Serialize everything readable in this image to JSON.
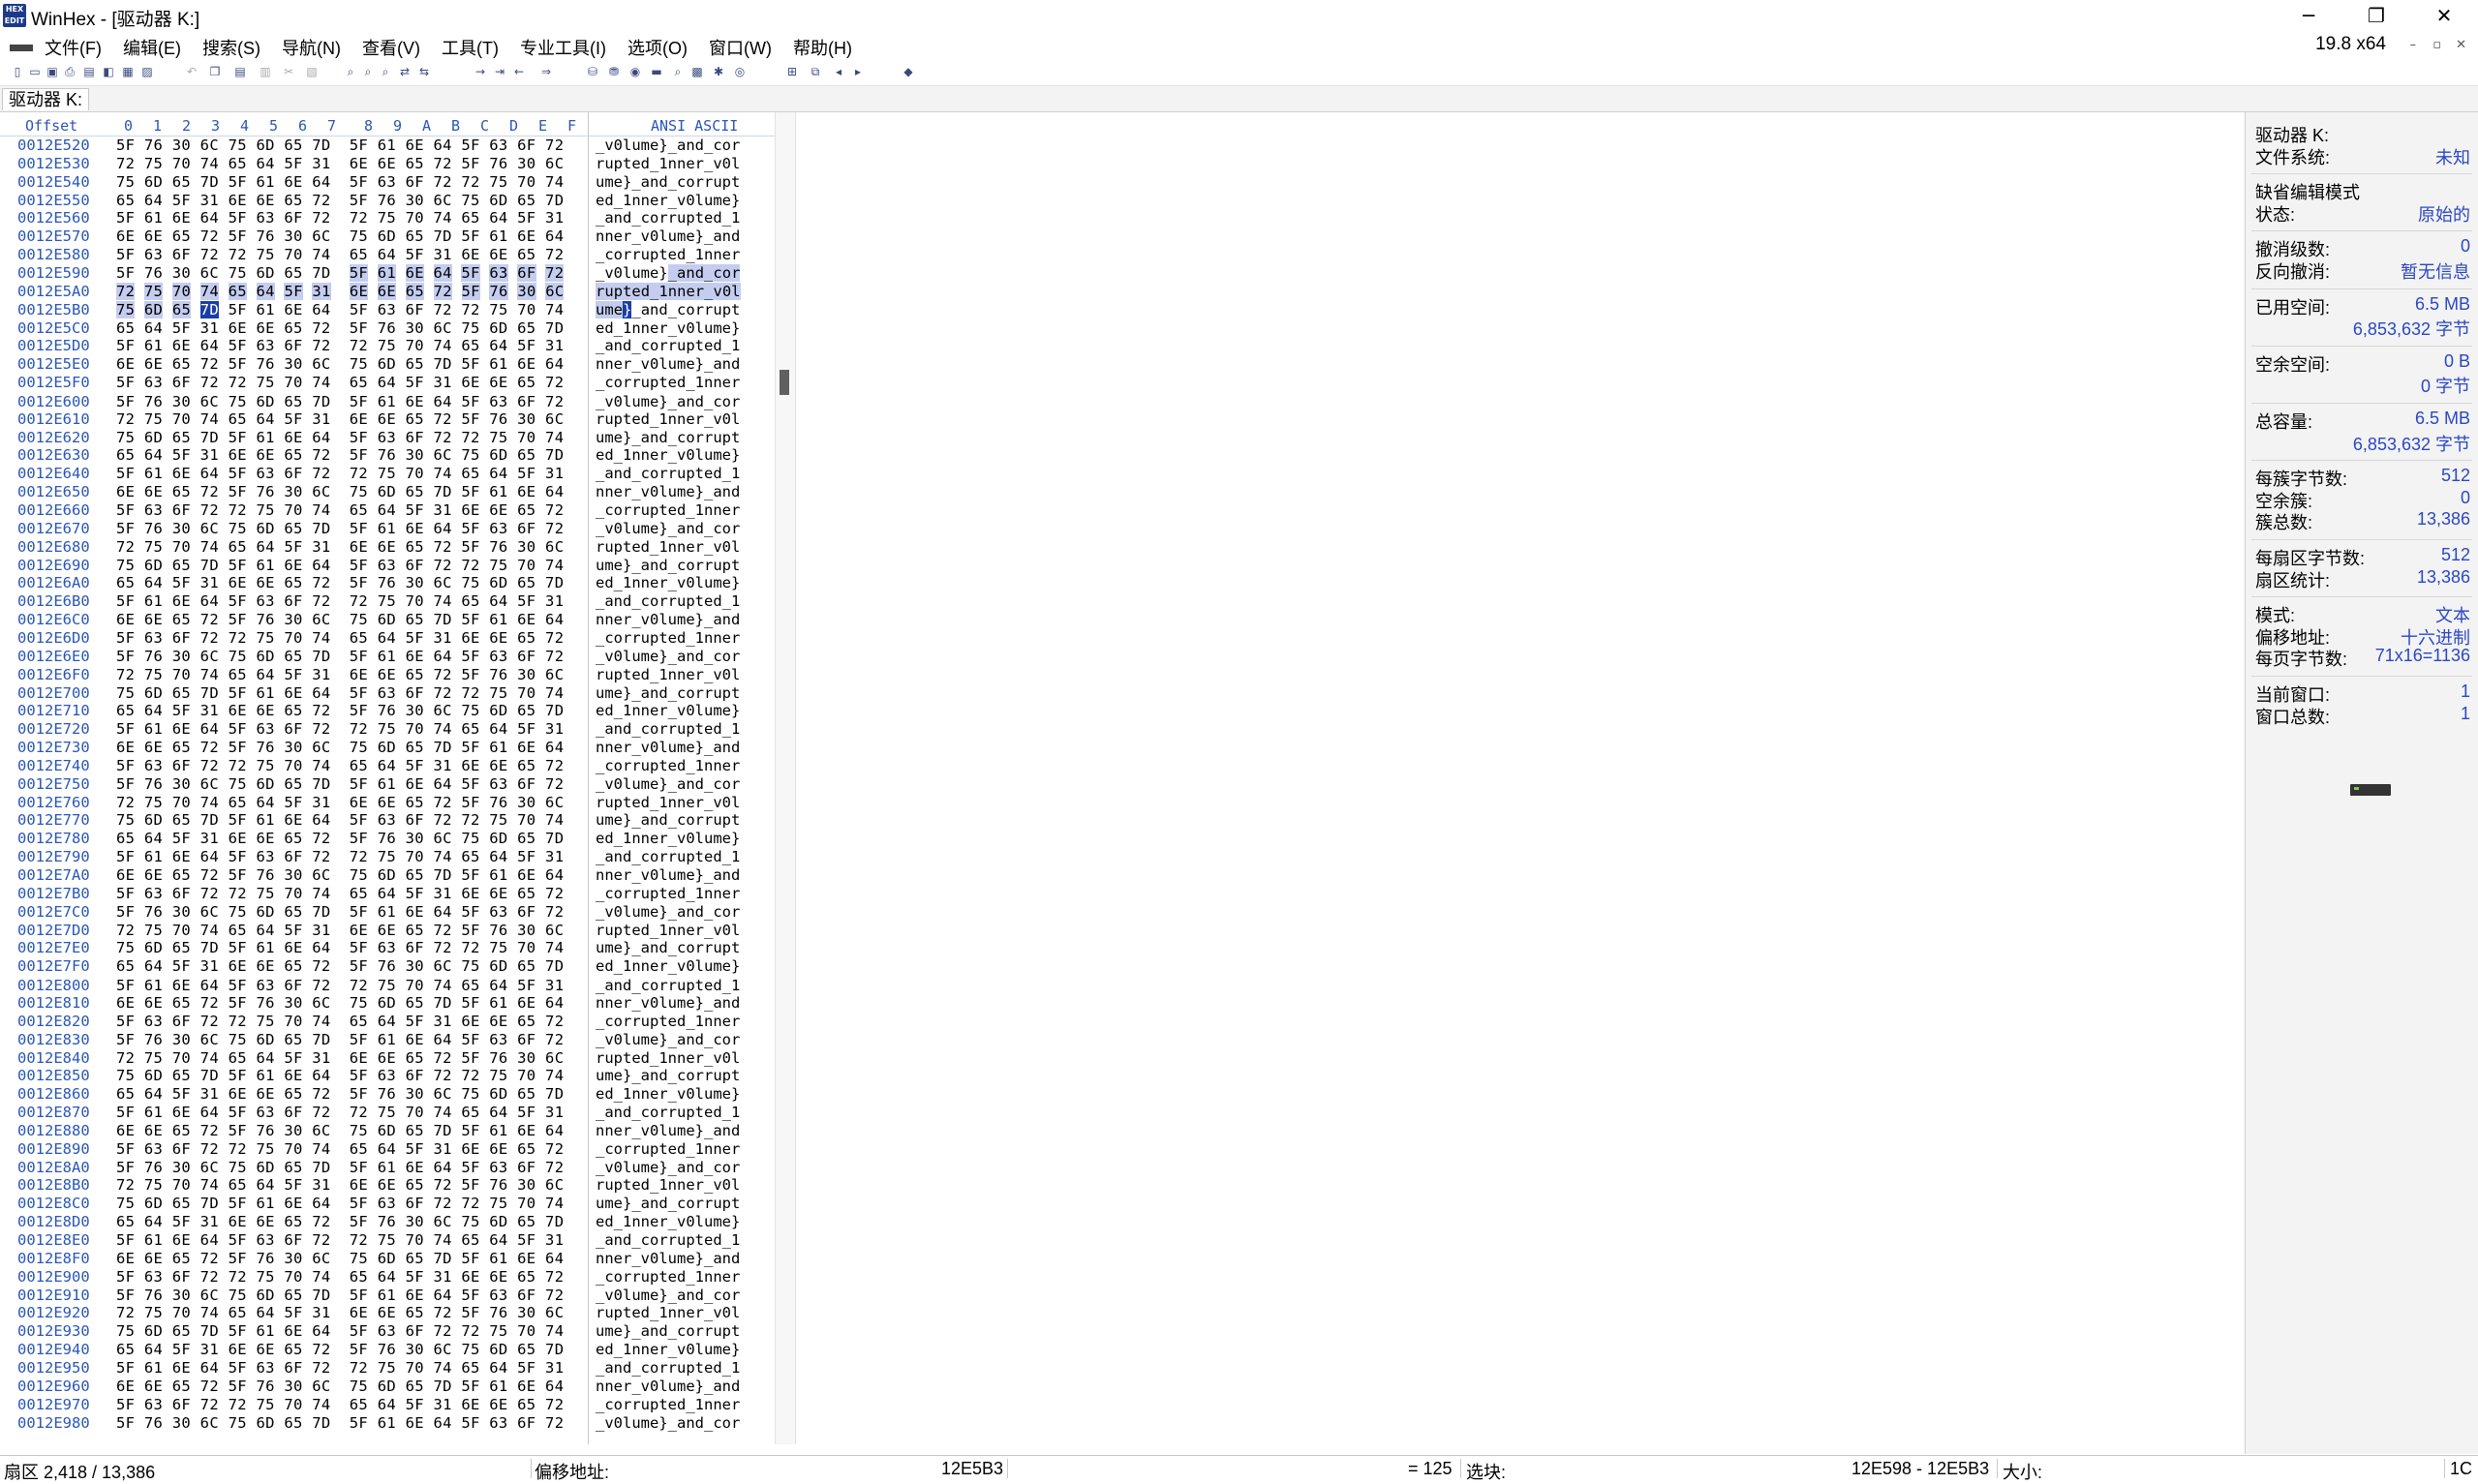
{
  "window": {
    "title": "WinHex - [驱动器 K:]",
    "icon_lines": [
      "HEX",
      "EDIT"
    ],
    "minimize_icon": "─",
    "restore_icon": "❐",
    "close_icon": "✕"
  },
  "menubar": {
    "items": [
      "文件(F)",
      "编辑(E)",
      "搜索(S)",
      "导航(N)",
      "查看(V)",
      "工具(T)",
      "专业工具(I)",
      "选项(O)",
      "窗口(W)",
      "帮助(H)"
    ],
    "version": "19.8 x64",
    "mdi_minimize": "–",
    "mdi_restore": "▫",
    "mdi_close": "✕"
  },
  "toolbar": {
    "icons": [
      "new-file",
      "open-file",
      "save-file",
      "print",
      "properties",
      "open-disk",
      "open-ram",
      "open-image",
      "undo",
      "copy",
      "paste",
      "paste-block",
      "cut",
      "binary-copy",
      "find-text",
      "find-hex",
      "find-next",
      "replace",
      "replace-hex",
      "goto-offset",
      "goto-sector",
      "back",
      "forward",
      "disk-tools",
      "disk-clone",
      "disk-image",
      "ram-tool",
      "search-tool",
      "calc-tool",
      "hash-tool",
      "analyze-tool",
      "tile-windows",
      "cascade-windows",
      "prev-window",
      "next-window",
      "view-tool"
    ]
  },
  "tab": {
    "label": "驱动器 K:"
  },
  "hexview": {
    "offset_header": "Offset",
    "columns": [
      "0",
      "1",
      "2",
      "3",
      "4",
      "5",
      "6",
      "7",
      "8",
      "9",
      "A",
      "B",
      "C",
      "D",
      "E",
      "F"
    ],
    "ascii_header": "ANSI ASCII",
    "rows": [
      {
        "o": "0012E520",
        "h": "5F 76 30 6C 75 6D 65 7D  5F 61 6E 64 5F 63 6F 72",
        "a": "_v0lume}_and_cor"
      },
      {
        "o": "0012E530",
        "h": "72 75 70 74 65 64 5F 31  6E 6E 65 72 5F 76 30 6C",
        "a": "rupted_1nner_v0l"
      },
      {
        "o": "0012E540",
        "h": "75 6D 65 7D 5F 61 6E 64  5F 63 6F 72 72 75 70 74",
        "a": "ume}_and_corrupt"
      },
      {
        "o": "0012E550",
        "h": "65 64 5F 31 6E 6E 65 72  5F 76 30 6C 75 6D 65 7D",
        "a": "ed_1nner_v0lume}"
      },
      {
        "o": "0012E560",
        "h": "5F 61 6E 64 5F 63 6F 72  72 75 70 74 65 64 5F 31",
        "a": "_and_corrupted_1"
      },
      {
        "o": "0012E570",
        "h": "6E 6E 65 72 5F 76 30 6C  75 6D 65 7D 5F 61 6E 64",
        "a": "nner_v0lume}_and"
      },
      {
        "o": "0012E580",
        "h": "5F 63 6F 72 72 75 70 74  65 64 5F 31 6E 6E 65 72",
        "a": "_corrupted_1nner"
      },
      {
        "o": "0012E590",
        "h": "5F 76 30 6C 75 6D 65 7D  5F 61 6E 64 5F 63 6F 72",
        "a": "_v0lume}_and_cor"
      },
      {
        "o": "0012E5A0",
        "h": "72 75 70 74 65 64 5F 31  6E 6E 65 72 5F 76 30 6C",
        "a": "rupted_1nner_v0l"
      },
      {
        "o": "0012E5B0",
        "h": "75 6D 65 7D 5F 61 6E 64  5F 63 6F 72 72 75 70 74",
        "a": "ume}_and_corrupt"
      },
      {
        "o": "0012E5C0",
        "h": "65 64 5F 31 6E 6E 65 72  5F 76 30 6C 75 6D 65 7D",
        "a": "ed_1nner_v0lume}"
      },
      {
        "o": "0012E5D0",
        "h": "5F 61 6E 64 5F 63 6F 72  72 75 70 74 65 64 5F 31",
        "a": "_and_corrupted_1"
      },
      {
        "o": "0012E5E0",
        "h": "6E 6E 65 72 5F 76 30 6C  75 6D 65 7D 5F 61 6E 64",
        "a": "nner_v0lume}_and"
      },
      {
        "o": "0012E5F0",
        "h": "5F 63 6F 72 72 75 70 74  65 64 5F 31 6E 6E 65 72",
        "a": "_corrupted_1nner"
      },
      {
        "o": "0012E600",
        "h": "5F 76 30 6C 75 6D 65 7D  5F 61 6E 64 5F 63 6F 72",
        "a": "_v0lume}_and_cor"
      },
      {
        "o": "0012E610",
        "h": "72 75 70 74 65 64 5F 31  6E 6E 65 72 5F 76 30 6C",
        "a": "rupted_1nner_v0l"
      },
      {
        "o": "0012E620",
        "h": "75 6D 65 7D 5F 61 6E 64  5F 63 6F 72 72 75 70 74",
        "a": "ume}_and_corrupt"
      },
      {
        "o": "0012E630",
        "h": "65 64 5F 31 6E 6E 65 72  5F 76 30 6C 75 6D 65 7D",
        "a": "ed_1nner_v0lume}"
      },
      {
        "o": "0012E640",
        "h": "5F 61 6E 64 5F 63 6F 72  72 75 70 74 65 64 5F 31",
        "a": "_and_corrupted_1"
      },
      {
        "o": "0012E650",
        "h": "6E 6E 65 72 5F 76 30 6C  75 6D 65 7D 5F 61 6E 64",
        "a": "nner_v0lume}_and"
      },
      {
        "o": "0012E660",
        "h": "5F 63 6F 72 72 75 70 74  65 64 5F 31 6E 6E 65 72",
        "a": "_corrupted_1nner"
      },
      {
        "o": "0012E670",
        "h": "5F 76 30 6C 75 6D 65 7D  5F 61 6E 64 5F 63 6F 72",
        "a": "_v0lume}_and_cor"
      },
      {
        "o": "0012E680",
        "h": "72 75 70 74 65 64 5F 31  6E 6E 65 72 5F 76 30 6C",
        "a": "rupted_1nner_v0l"
      },
      {
        "o": "0012E690",
        "h": "75 6D 65 7D 5F 61 6E 64  5F 63 6F 72 72 75 70 74",
        "a": "ume}_and_corrupt"
      },
      {
        "o": "0012E6A0",
        "h": "65 64 5F 31 6E 6E 65 72  5F 76 30 6C 75 6D 65 7D",
        "a": "ed_1nner_v0lume}"
      },
      {
        "o": "0012E6B0",
        "h": "5F 61 6E 64 5F 63 6F 72  72 75 70 74 65 64 5F 31",
        "a": "_and_corrupted_1"
      },
      {
        "o": "0012E6C0",
        "h": "6E 6E 65 72 5F 76 30 6C  75 6D 65 7D 5F 61 6E 64",
        "a": "nner_v0lume}_and"
      },
      {
        "o": "0012E6D0",
        "h": "5F 63 6F 72 72 75 70 74  65 64 5F 31 6E 6E 65 72",
        "a": "_corrupted_1nner"
      },
      {
        "o": "0012E6E0",
        "h": "5F 76 30 6C 75 6D 65 7D  5F 61 6E 64 5F 63 6F 72",
        "a": "_v0lume}_and_cor"
      },
      {
        "o": "0012E6F0",
        "h": "72 75 70 74 65 64 5F 31  6E 6E 65 72 5F 76 30 6C",
        "a": "rupted_1nner_v0l"
      },
      {
        "o": "0012E700",
        "h": "75 6D 65 7D 5F 61 6E 64  5F 63 6F 72 72 75 70 74",
        "a": "ume}_and_corrupt"
      },
      {
        "o": "0012E710",
        "h": "65 64 5F 31 6E 6E 65 72  5F 76 30 6C 75 6D 65 7D",
        "a": "ed_1nner_v0lume}"
      },
      {
        "o": "0012E720",
        "h": "5F 61 6E 64 5F 63 6F 72  72 75 70 74 65 64 5F 31",
        "a": "_and_corrupted_1"
      },
      {
        "o": "0012E730",
        "h": "6E 6E 65 72 5F 76 30 6C  75 6D 65 7D 5F 61 6E 64",
        "a": "nner_v0lume}_and"
      },
      {
        "o": "0012E740",
        "h": "5F 63 6F 72 72 75 70 74  65 64 5F 31 6E 6E 65 72",
        "a": "_corrupted_1nner"
      },
      {
        "o": "0012E750",
        "h": "5F 76 30 6C 75 6D 65 7D  5F 61 6E 64 5F 63 6F 72",
        "a": "_v0lume}_and_cor"
      },
      {
        "o": "0012E760",
        "h": "72 75 70 74 65 64 5F 31  6E 6E 65 72 5F 76 30 6C",
        "a": "rupted_1nner_v0l"
      },
      {
        "o": "0012E770",
        "h": "75 6D 65 7D 5F 61 6E 64  5F 63 6F 72 72 75 70 74",
        "a": "ume}_and_corrupt"
      },
      {
        "o": "0012E780",
        "h": "65 64 5F 31 6E 6E 65 72  5F 76 30 6C 75 6D 65 7D",
        "a": "ed_1nner_v0lume}"
      },
      {
        "o": "0012E790",
        "h": "5F 61 6E 64 5F 63 6F 72  72 75 70 74 65 64 5F 31",
        "a": "_and_corrupted_1"
      },
      {
        "o": "0012E7A0",
        "h": "6E 6E 65 72 5F 76 30 6C  75 6D 65 7D 5F 61 6E 64",
        "a": "nner_v0lume}_and"
      },
      {
        "o": "0012E7B0",
        "h": "5F 63 6F 72 72 75 70 74  65 64 5F 31 6E 6E 65 72",
        "a": "_corrupted_1nner"
      },
      {
        "o": "0012E7C0",
        "h": "5F 76 30 6C 75 6D 65 7D  5F 61 6E 64 5F 63 6F 72",
        "a": "_v0lume}_and_cor"
      },
      {
        "o": "0012E7D0",
        "h": "72 75 70 74 65 64 5F 31  6E 6E 65 72 5F 76 30 6C",
        "a": "rupted_1nner_v0l"
      },
      {
        "o": "0012E7E0",
        "h": "75 6D 65 7D 5F 61 6E 64  5F 63 6F 72 72 75 70 74",
        "a": "ume}_and_corrupt"
      },
      {
        "o": "0012E7F0",
        "h": "65 64 5F 31 6E 6E 65 72  5F 76 30 6C 75 6D 65 7D",
        "a": "ed_1nner_v0lume}"
      },
      {
        "o": "0012E800",
        "h": "5F 61 6E 64 5F 63 6F 72  72 75 70 74 65 64 5F 31",
        "a": "_and_corrupted_1"
      },
      {
        "o": "0012E810",
        "h": "6E 6E 65 72 5F 76 30 6C  75 6D 65 7D 5F 61 6E 64",
        "a": "nner_v0lume}_and"
      },
      {
        "o": "0012E820",
        "h": "5F 63 6F 72 72 75 70 74  65 64 5F 31 6E 6E 65 72",
        "a": "_corrupted_1nner"
      },
      {
        "o": "0012E830",
        "h": "5F 76 30 6C 75 6D 65 7D  5F 61 6E 64 5F 63 6F 72",
        "a": "_v0lume}_and_cor"
      },
      {
        "o": "0012E840",
        "h": "72 75 70 74 65 64 5F 31  6E 6E 65 72 5F 76 30 6C",
        "a": "rupted_1nner_v0l"
      },
      {
        "o": "0012E850",
        "h": "75 6D 65 7D 5F 61 6E 64  5F 63 6F 72 72 75 70 74",
        "a": "ume}_and_corrupt"
      },
      {
        "o": "0012E860",
        "h": "65 64 5F 31 6E 6E 65 72  5F 76 30 6C 75 6D 65 7D",
        "a": "ed_1nner_v0lume}"
      },
      {
        "o": "0012E870",
        "h": "5F 61 6E 64 5F 63 6F 72  72 75 70 74 65 64 5F 31",
        "a": "_and_corrupted_1"
      },
      {
        "o": "0012E880",
        "h": "6E 6E 65 72 5F 76 30 6C  75 6D 65 7D 5F 61 6E 64",
        "a": "nner_v0lume}_and"
      },
      {
        "o": "0012E890",
        "h": "5F 63 6F 72 72 75 70 74  65 64 5F 31 6E 6E 65 72",
        "a": "_corrupted_1nner"
      },
      {
        "o": "0012E8A0",
        "h": "5F 76 30 6C 75 6D 65 7D  5F 61 6E 64 5F 63 6F 72",
        "a": "_v0lume}_and_cor"
      },
      {
        "o": "0012E8B0",
        "h": "72 75 70 74 65 64 5F 31  6E 6E 65 72 5F 76 30 6C",
        "a": "rupted_1nner_v0l"
      },
      {
        "o": "0012E8C0",
        "h": "75 6D 65 7D 5F 61 6E 64  5F 63 6F 72 72 75 70 74",
        "a": "ume}_and_corrupt"
      },
      {
        "o": "0012E8D0",
        "h": "65 64 5F 31 6E 6E 65 72  5F 76 30 6C 75 6D 65 7D",
        "a": "ed_1nner_v0lume}"
      },
      {
        "o": "0012E8E0",
        "h": "5F 61 6E 64 5F 63 6F 72  72 75 70 74 65 64 5F 31",
        "a": "_and_corrupted_1"
      },
      {
        "o": "0012E8F0",
        "h": "6E 6E 65 72 5F 76 30 6C  75 6D 65 7D 5F 61 6E 64",
        "a": "nner_v0lume}_and"
      },
      {
        "o": "0012E900",
        "h": "5F 63 6F 72 72 75 70 74  65 64 5F 31 6E 6E 65 72",
        "a": "_corrupted_1nner"
      },
      {
        "o": "0012E910",
        "h": "5F 76 30 6C 75 6D 65 7D  5F 61 6E 64 5F 63 6F 72",
        "a": "_v0lume}_and_cor"
      },
      {
        "o": "0012E920",
        "h": "72 75 70 74 65 64 5F 31  6E 6E 65 72 5F 76 30 6C",
        "a": "rupted_1nner_v0l"
      },
      {
        "o": "0012E930",
        "h": "75 6D 65 7D 5F 61 6E 64  5F 63 6F 72 72 75 70 74",
        "a": "ume}_and_corrupt"
      },
      {
        "o": "0012E940",
        "h": "65 64 5F 31 6E 6E 65 72  5F 76 30 6C 75 6D 65 7D",
        "a": "ed_1nner_v0lume}"
      },
      {
        "o": "0012E950",
        "h": "5F 61 6E 64 5F 63 6F 72  72 75 70 74 65 64 5F 31",
        "a": "_and_corrupted_1"
      },
      {
        "o": "0012E960",
        "h": "6E 6E 65 72 5F 76 30 6C  75 6D 65 7D 5F 61 6E 64",
        "a": "nner_v0lume}_and"
      },
      {
        "o": "0012E970",
        "h": "5F 63 6F 72 72 75 70 74  65 64 5F 31 6E 6E 65 72",
        "a": "_corrupted_1nner"
      },
      {
        "o": "0012E980",
        "h": "5F 76 30 6C 75 6D 65 7D  5F 61 6E 64 5F 63 6F 72",
        "a": "_v0lume}_and_cor"
      }
    ]
  },
  "infopanel": {
    "groups": [
      [
        {
          "k": "驱动器 K:",
          "v": ""
        },
        {
          "k": "文件系统:",
          "v": "未知"
        }
      ],
      [
        {
          "k": "缺省编辑模式",
          "v": ""
        },
        {
          "k": "状态:",
          "v": "原始的"
        }
      ],
      [
        {
          "k": "撤消级数:",
          "v": "0"
        },
        {
          "k": "反向撤消:",
          "v": "暂无信息"
        }
      ],
      [
        {
          "k": "已用空间:",
          "v": "6.5 MB"
        },
        {
          "k": "",
          "v": "6,853,632 字节"
        }
      ],
      [
        {
          "k": "空余空间:",
          "v": "0 B"
        },
        {
          "k": "",
          "v": "0 字节"
        }
      ],
      [
        {
          "k": "总容量:",
          "v": "6.5 MB"
        },
        {
          "k": "",
          "v": "6,853,632 字节"
        }
      ],
      [
        {
          "k": "每簇字节数:",
          "v": "512"
        },
        {
          "k": "空余簇:",
          "v": "0"
        },
        {
          "k": "簇总数:",
          "v": "13,386"
        }
      ],
      [
        {
          "k": "每扇区字节数:",
          "v": "512"
        },
        {
          "k": "扇区统计:",
          "v": "13,386"
        }
      ],
      [
        {
          "k": "模式:",
          "v": "文本"
        },
        {
          "k": "偏移地址:",
          "v": "十六进制"
        },
        {
          "k": "每页字节数:",
          "v": "71x16=1136"
        }
      ],
      [
        {
          "k": "当前窗口:",
          "v": "1"
        },
        {
          "k": "窗口总数:",
          "v": "1"
        }
      ]
    ],
    "drive_icon": "drive-icon"
  },
  "statusbar": {
    "sector": "扇区 2,418 / 13,386",
    "offset_label": "偏移地址:",
    "offset_value": "12E5B3",
    "byte_value": "= 125",
    "block_label": "选块:",
    "block_range": "12E598 - 12E5B3",
    "size_label": "大小:",
    "size_value": "1C"
  },
  "colors": {
    "accent": "#2a56b8",
    "selection": "#c4cdf0",
    "caret": "#1a3ea8",
    "info_value": "#2a48c4"
  }
}
